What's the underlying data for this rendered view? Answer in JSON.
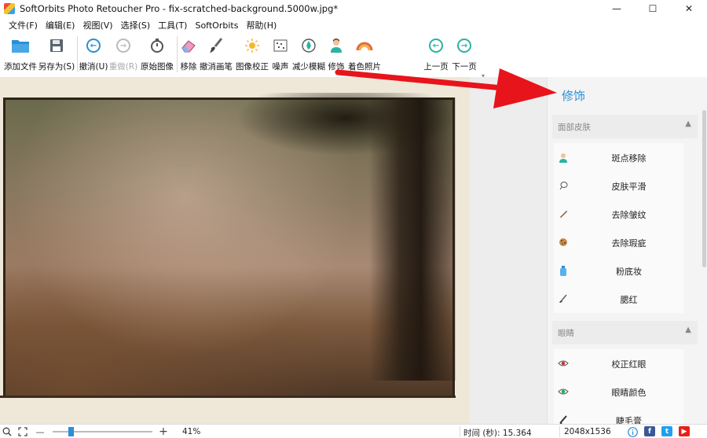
{
  "window": {
    "title": "SoftOrbits Photo Retoucher Pro - fix-scratched-background.5000w.jpg*",
    "minimize": "—",
    "maximize": "☐",
    "close": "✕"
  },
  "menu": [
    "文件(F)",
    "编辑(E)",
    "视图(V)",
    "选择(S)",
    "工具(T)",
    "SoftOrbits",
    "帮助(H)"
  ],
  "toolbar": {
    "add_file": "添加文件",
    "save_as": "另存为(S)",
    "undo": "撤消(U)",
    "redo": "重做(R)",
    "original": "原始图像",
    "remove": "移除",
    "undo_brush": "撤消画笔",
    "correct": "图像校正",
    "noise": "噪声",
    "reduce_blur": "减少模糊",
    "retouch": "修饰",
    "colorize": "着色照片",
    "prev": "上一页",
    "next": "下一页",
    "more": "▾"
  },
  "panel": {
    "title": "修饰",
    "sections": [
      {
        "name": "面部皮肤",
        "caret": "▲",
        "items": [
          {
            "label": "斑点移除",
            "icon": "face-icon"
          },
          {
            "label": "皮肤平滑",
            "icon": "lasso-icon"
          },
          {
            "label": "去除皱纹",
            "icon": "pencil-icon"
          },
          {
            "label": "去除瑕疵",
            "icon": "cookie-icon"
          },
          {
            "label": "粉底妆",
            "icon": "bottle-icon"
          },
          {
            "label": "腮红",
            "icon": "brush-icon"
          }
        ]
      },
      {
        "name": "眼睛",
        "caret": "▲",
        "items": [
          {
            "label": "校正红眼",
            "icon": "red-eye-icon"
          },
          {
            "label": "眼睛颜色",
            "icon": "eye-color-icon"
          },
          {
            "label": "睫毛膏",
            "icon": "mascara-icon"
          }
        ]
      }
    ]
  },
  "status": {
    "zoom_minus": "—",
    "zoom_plus": "+",
    "zoom": "41%",
    "zoom_level": 0.19,
    "time": "时间 (秒): 15.364",
    "dimensions": "2048x1536"
  },
  "colors": {
    "accent": "#2a8fd6",
    "arrow": "#e8141b"
  }
}
